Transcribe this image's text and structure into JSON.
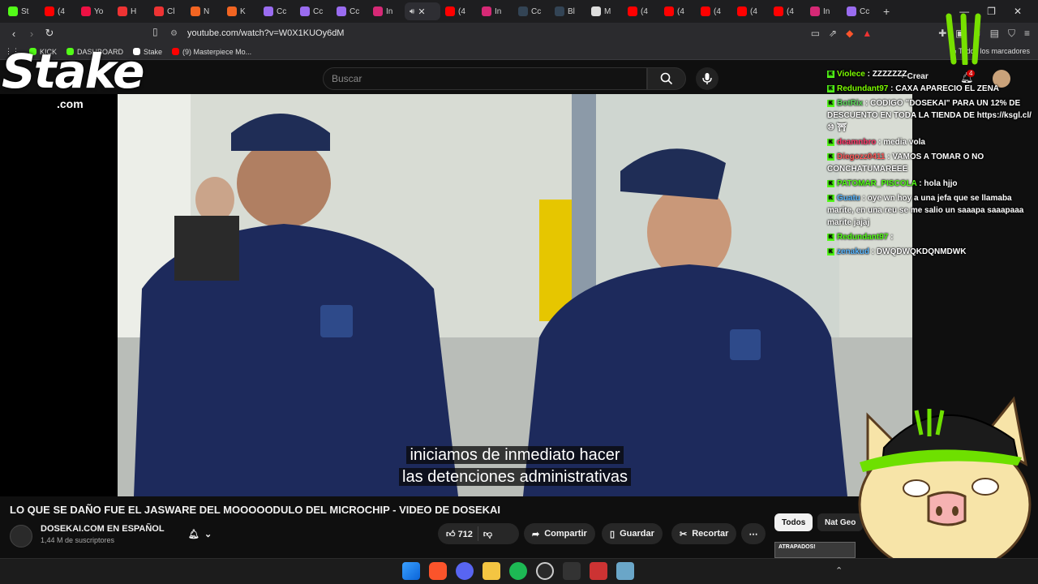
{
  "browser": {
    "tabs": [
      {
        "label": "St",
        "color": "#53fc18"
      },
      {
        "label": "(4",
        "color": "#ff0000"
      },
      {
        "label": "Yo",
        "color": "#e14"
      },
      {
        "label": "H",
        "color": "#e33"
      },
      {
        "label": "Cl",
        "color": "#e33"
      },
      {
        "label": "N",
        "color": "#f26522"
      },
      {
        "label": "K",
        "color": "#f26522"
      },
      {
        "label": "Cc",
        "color": "#9a6cf0"
      },
      {
        "label": "Cc",
        "color": "#9a6cf0"
      },
      {
        "label": "Cc",
        "color": "#9a6cf0"
      },
      {
        "label": "In",
        "color": "#d62976"
      }
    ],
    "tabs_right": [
      {
        "label": "(4",
        "color": "#ff0000"
      },
      {
        "label": "In",
        "color": "#d62976"
      },
      {
        "label": "Cc",
        "color": "#345"
      },
      {
        "label": "Bl",
        "color": "#345"
      },
      {
        "label": "M",
        "color": "#ddd"
      },
      {
        "label": "(4",
        "color": "#ff0000"
      },
      {
        "label": "(4",
        "color": "#ff0000"
      },
      {
        "label": "(4",
        "color": "#ff0000"
      },
      {
        "label": "(4",
        "color": "#ff0000"
      },
      {
        "label": "(4",
        "color": "#ff0000"
      },
      {
        "label": "In",
        "color": "#d62976"
      },
      {
        "label": "Cc",
        "color": "#9a6cf0"
      }
    ],
    "active_tab_close": "✕",
    "new_tab": "+",
    "url": "youtube.com/watch?v=W0X1KUOy6dM",
    "bookmarks": [
      {
        "label": "KICK",
        "color": "#53fc18"
      },
      {
        "label": "DASHBOARD",
        "color": "#53fc18"
      },
      {
        "label": "Stake",
        "color": "#ffffff"
      },
      {
        "label": "(9) Masterpiece Mo...",
        "color": "#ff0000"
      }
    ],
    "all_bookmarks": "Todos los marcadores"
  },
  "youtube": {
    "search_placeholder": "Buscar",
    "create_label": "Crear",
    "notif_count": "4",
    "video_title": "LO QUE SE DAÑO FUE EL JASWARE DEL MOOOOODULO DEL MICROCHIP - VIDEO DE DOSEKAI",
    "channel_name": "DOSEKAI.COM EN ESPAÑOL",
    "subscribers": "1,44 M de suscriptores",
    "likes": "712",
    "share": "Compartir",
    "save": "Guardar",
    "clip": "Recortar",
    "more": "⋯",
    "chips": [
      "Todos",
      "Nat Geo"
    ],
    "subtitle_1": "iniciamos de inmediato hacer",
    "subtitle_2": "las detenciones administrativas",
    "thumb_label": "ATRAPADOS!"
  },
  "overlay": {
    "stake_logo": "Stake",
    "stake_com": ".com"
  },
  "chat": [
    {
      "user": "Violece",
      "user_color": "#7cfc00",
      "msg": ": ZZZZZZZ"
    },
    {
      "user": "Redundant97",
      "user_color": "#7cfc00",
      "msg": ": CAXA APARECIO EL ZENA"
    },
    {
      "user": "BotRix",
      "user_color": "#5cd65c",
      "msg": ": CODIGO \"DOSEKAI\" PARA UN 12% DE DESCUENTO EN TODA LA TIENDA DE https://ksgl.cl/ ⑩ ⛩"
    },
    {
      "user": "deamnbro",
      "user_color": "#ff3b6b",
      "msg": ": media vola"
    },
    {
      "user": "Diegozz0411",
      "user_color": "#ff5c5c",
      "msg": ": VAMOS A TOMAR O NO CONCHATUMAREEE"
    },
    {
      "user": "PATOMAR_PISCOLA",
      "user_color": "#53fc18",
      "msg": ": hola hjjo"
    },
    {
      "user": "Guatu",
      "user_color": "#59b6ff",
      "msg": ": oye wn hoy a una jefa que se llamaba marite, en una reu se me salio un saaapa saaapaaa marite jajaj"
    },
    {
      "user": "Redundant97",
      "user_color": "#53fc18",
      "msg": ":"
    },
    {
      "user": "zenakud",
      "user_color": "#59b6ff",
      "msg": ": DWQDWQKDQNMDWK"
    }
  ]
}
